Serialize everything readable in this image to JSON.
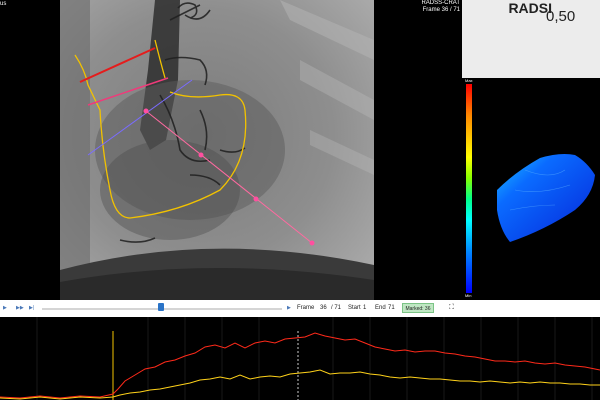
{
  "header": {
    "top_left_label": "us",
    "top_right_line1": "RADSS-CRAT",
    "top_right_line2": "Frame 36 / 71"
  },
  "result_panel": {
    "ratio_label": "RADSI",
    "ratio_value": "0,50"
  },
  "color_scale": {
    "max_label": "Max",
    "min_label": "Min"
  },
  "playback": {
    "frame_label": "Frame",
    "frame_current": "36",
    "frame_total": "/ 71",
    "start_label": "Start",
    "start_value": "1",
    "end_label": "End",
    "end_value": "71",
    "marked_button": "Marked: 36",
    "slider_position": 0.5
  },
  "colors": {
    "series_red": "#ff2a1a",
    "series_yellow": "#ffd21a",
    "marker": "#f5c400",
    "accent_button": "#bfe7c3",
    "slider": "#2a73c7"
  },
  "icons": [
    "play-icon",
    "fast-forward-icon",
    "skip-end-icon",
    "next-frame-icon",
    "fullscreen-icon"
  ]
}
